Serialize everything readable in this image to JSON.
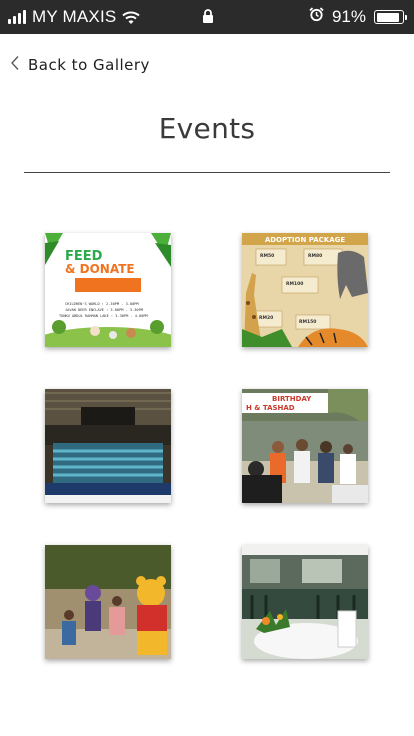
{
  "status_bar": {
    "carrier": "MY MAXIS",
    "battery": "91%",
    "battery_level": 0.91
  },
  "nav": {
    "back_label": "Back to Gallery"
  },
  "page": {
    "title": "Events"
  },
  "gallery": {
    "poster1": {
      "heading_line1": "FEED",
      "heading_line2": "& DONATE",
      "rows": [
        "CHILDREN'S WORLD : 2.30PM - 3.00PM",
        "JAVAN DEER ENCLAVE : 3.00PM - 3.30PM",
        "TUNKU ABDUL RAHMAN LAKE : 3.30PM - 4.00PM"
      ]
    },
    "poster2": {
      "heading": "ADOPTION PACKAGE",
      "prices": [
        "RM50",
        "RM80",
        "RM100",
        "RM20",
        "RM150"
      ]
    },
    "photo4": {
      "banner_text_1": "BIRTHDAY",
      "banner_text_2": "H & TASHAD"
    }
  }
}
